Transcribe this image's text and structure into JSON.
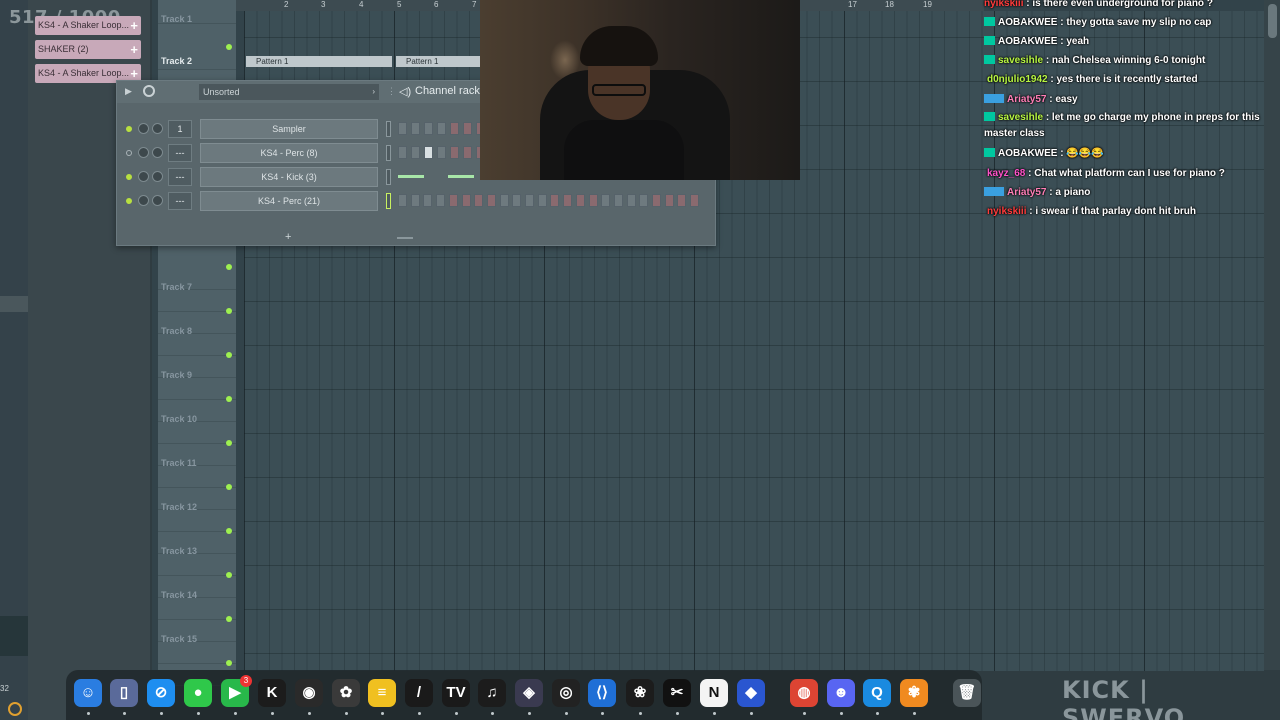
{
  "counter": "517 / 1000",
  "browser": {
    "items": [
      "KS4 - A Shaker Loop...",
      "SHAKER (2)",
      "KS4 - A Shaker Loop..."
    ]
  },
  "corner_clock": "32",
  "ruler": {
    "marks": [
      "2",
      "3",
      "4",
      "5",
      "6",
      "7",
      "17",
      "18",
      "19"
    ]
  },
  "tracks": [
    {
      "name": "Track 1"
    },
    {
      "name": "Track 2"
    },
    {
      "name": "Track 7"
    },
    {
      "name": "Track 8"
    },
    {
      "name": "Track 9"
    },
    {
      "name": "Track 10"
    },
    {
      "name": "Track 11"
    },
    {
      "name": "Track 12"
    },
    {
      "name": "Track 13"
    },
    {
      "name": "Track 14"
    },
    {
      "name": "Track 15"
    }
  ],
  "patterns": [
    "Pattern 1",
    "Pattern 1"
  ],
  "channel_rack": {
    "filter": "Unsorted",
    "title": "Channel rack",
    "channels": [
      {
        "route": "1",
        "name": "Sampler"
      },
      {
        "route": "---",
        "name": "KS4 - Perc (8)"
      },
      {
        "route": "---",
        "name": "KS4 - Kick (3)"
      },
      {
        "route": "---",
        "name": "KS4 - Perc (21)"
      }
    ],
    "add_label": "+"
  },
  "chat": [
    {
      "user": "nyikskiii",
      "color": "#ff3b3b",
      "badge": "",
      "msg": " : is there even underground for piano ?"
    },
    {
      "user": "AOBAKWEE",
      "color": "#ffffff",
      "badge": "mod",
      "msg": " : they gotta save my slip no cap"
    },
    {
      "user": "AOBAKWEE",
      "color": "#ffffff",
      "badge": "mod",
      "msg": " : yeah"
    },
    {
      "user": "savesihle",
      "color": "#b7f542",
      "badge": "mod",
      "msg": " : nah Chelsea winning 6-0 tonight"
    },
    {
      "user": "d0njulio1942",
      "color": "#b7f542",
      "badge": "",
      "msg": " : yes there is it recently started"
    },
    {
      "user": "Ariaty57",
      "color": "#ff7eb6",
      "badge": "vip",
      "msg": " : easy"
    },
    {
      "user": "savesihle",
      "color": "#b7f542",
      "badge": "mod",
      "msg": " : let me go charge my phone in preps for this master class"
    },
    {
      "user": "AOBAKWEE",
      "color": "#ffffff",
      "badge": "mod",
      "msg": " : 😂😂😂"
    },
    {
      "user": "kayz_68",
      "color": "#ff52c9",
      "badge": "",
      "msg": " : Chat what platform can I use for piano ?"
    },
    {
      "user": "Ariaty57",
      "color": "#ff7eb6",
      "badge": "vip",
      "msg": " : a piano"
    },
    {
      "user": "nyikskiii",
      "color": "#ff3b3b",
      "badge": "",
      "msg": " : i swear if that parlay dont hit bruh"
    }
  ],
  "dock": {
    "apps": [
      {
        "name": "finder",
        "glyph": "☺",
        "bg": "#2a7de1"
      },
      {
        "name": "files",
        "glyph": "▯",
        "bg": "#5a6a9a"
      },
      {
        "name": "safari",
        "glyph": "⊘",
        "bg": "#1e8ef0"
      },
      {
        "name": "messages",
        "glyph": "●",
        "bg": "#2fc84a"
      },
      {
        "name": "facetime",
        "glyph": "▶",
        "bg": "#28b84a"
      },
      {
        "name": "kick",
        "glyph": "K",
        "bg": "#1c1c1c"
      },
      {
        "name": "obs",
        "glyph": "◉",
        "bg": "#2a2a2a"
      },
      {
        "name": "fl-studio",
        "glyph": "✿",
        "bg": "#3a3a3a"
      },
      {
        "name": "notes",
        "glyph": "≡",
        "bg": "#f0c020"
      },
      {
        "name": "pen",
        "glyph": "/",
        "bg": "#1a1a1a"
      },
      {
        "name": "tradingview",
        "glyph": "TV",
        "bg": "#1a1a1a"
      },
      {
        "name": "music",
        "glyph": "♫",
        "bg": "#1c1c1c"
      },
      {
        "name": "davinci",
        "glyph": "◈",
        "bg": "#3a3a50"
      },
      {
        "name": "github",
        "glyph": "◎",
        "bg": "#222"
      },
      {
        "name": "vscode",
        "glyph": "⟨⟩",
        "bg": "#1f6fd6"
      },
      {
        "name": "chatgpt",
        "glyph": "❀",
        "bg": "#1c1c1c"
      },
      {
        "name": "capcut",
        "glyph": "✂",
        "bg": "#111"
      },
      {
        "name": "notion",
        "glyph": "N",
        "bg": "#f4f4f4"
      },
      {
        "name": "roblox",
        "glyph": "◆",
        "bg": "#2a56d0"
      },
      {
        "name": "chrome",
        "glyph": "◍",
        "bg": "#dd4433"
      },
      {
        "name": "discord",
        "glyph": "☻",
        "bg": "#5865f2"
      },
      {
        "name": "quicktime",
        "glyph": "Q",
        "bg": "#1a8ae0"
      },
      {
        "name": "photos",
        "glyph": "✾",
        "bg": "#f08a20"
      },
      {
        "name": "trash",
        "glyph": "🗑",
        "bg": "#4a5458"
      }
    ],
    "badge": "3"
  },
  "watermark": "KICK | SWERVO"
}
